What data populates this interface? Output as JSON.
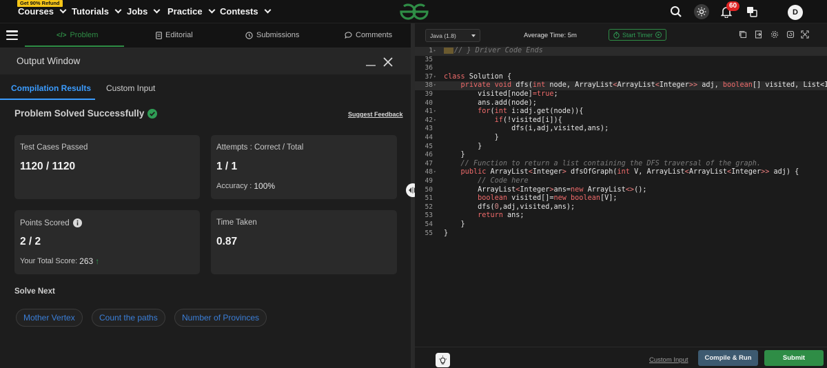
{
  "nav": {
    "refund_badge": "Get 90% Refund",
    "items": [
      {
        "label": "Courses"
      },
      {
        "label": "Tutorials"
      },
      {
        "label": "Jobs"
      },
      {
        "label": "Practice"
      },
      {
        "label": "Contests"
      }
    ],
    "notification_count": "60",
    "avatar_initial": "D",
    "icons": [
      "search-icon",
      "theme-toggle-icon",
      "bell-icon",
      "translate-icon"
    ]
  },
  "problem_tabs": [
    {
      "label": "Problem",
      "icon": "code-icon",
      "active": true
    },
    {
      "label": "Editorial",
      "icon": "document-icon",
      "active": false
    },
    {
      "label": "Submissions",
      "icon": "clock-icon",
      "active": false
    },
    {
      "label": "Comments",
      "icon": "comment-icon",
      "active": false
    }
  ],
  "output_window": {
    "title": "Output Window",
    "tabs": [
      {
        "label": "Compilation Results",
        "active": true
      },
      {
        "label": "Custom Input",
        "active": false
      }
    ],
    "status": "Problem Solved Successfully",
    "feedback_link": "Suggest Feedback",
    "cards": {
      "test_cases": {
        "label": "Test Cases Passed",
        "value": "1120 / 1120"
      },
      "attempts": {
        "label": "Attempts : Correct / Total",
        "value": "1 / 1",
        "sub_label": "Accuracy :",
        "sub_value": "100%"
      },
      "points": {
        "label": "Points Scored",
        "value": "2 / 2",
        "sub_label": "Your Total Score:",
        "sub_value": "263"
      },
      "time": {
        "label": "Time Taken",
        "value": "0.87"
      }
    },
    "solve_next": {
      "heading": "Solve Next",
      "items": [
        "Mother Vertex",
        "Count the paths",
        "Number of Provinces"
      ]
    }
  },
  "editor": {
    "language": "Java (1.8)",
    "average_time": "Average Time: 5m",
    "start_timer": "Start Timer",
    "lines": [
      {
        "n": "1",
        "fold": "▸",
        "html": "<span class=\"fold-mark\"></span><span class=\"cm\">// } Driver Code Ends</span>",
        "hl": true
      },
      {
        "n": "35",
        "fold": "",
        "html": ""
      },
      {
        "n": "36",
        "fold": "",
        "html": ""
      },
      {
        "n": "37",
        "fold": "▾",
        "html": "<span class=\"kw\">class</span> Solution {"
      },
      {
        "n": "38",
        "fold": "▾",
        "html": "    <span class=\"kw\">private</span> <span class=\"kw\">void</span> dfs(<span class=\"kw\">int</span> node, ArrayList<span class=\"gen\">&lt;</span>ArrayList<span class=\"gen\">&lt;</span>Integer<span class=\"gen\">&gt;&gt;</span> adj, <span class=\"kw\">boolean</span>[] visited, List&lt;Int",
        "hl": true
      },
      {
        "n": "39",
        "fold": "",
        "html": "        visited[node]<span class=\"kw\">=true</span>;"
      },
      {
        "n": "40",
        "fold": "",
        "html": "        ans.add(node);"
      },
      {
        "n": "41",
        "fold": "▾",
        "html": "        <span class=\"kw\">for</span>(<span class=\"kw\">int</span> i:adj.get(node)){"
      },
      {
        "n": "42",
        "fold": "▾",
        "html": "            <span class=\"kw\">if</span>(!visited[i]){"
      },
      {
        "n": "43",
        "fold": "",
        "html": "                dfs(i,adj,visited,ans);"
      },
      {
        "n": "44",
        "fold": "",
        "html": "            }"
      },
      {
        "n": "45",
        "fold": "",
        "html": "        }"
      },
      {
        "n": "46",
        "fold": "",
        "html": "    }"
      },
      {
        "n": "47",
        "fold": "",
        "html": "    <span class=\"cm\">// Function to return a list containing the DFS traversal of the graph.</span>"
      },
      {
        "n": "48",
        "fold": "▾",
        "html": "    <span class=\"kw\">public</span> ArrayList<span class=\"gen\">&lt;</span>Integer<span class=\"gen\">&gt;</span> dfsOfGraph(<span class=\"kw\">int</span> V, ArrayList<span class=\"gen\">&lt;</span>ArrayList<span class=\"gen\">&lt;</span>Integer<span class=\"gen\">&gt;&gt;</span> adj) {"
      },
      {
        "n": "49",
        "fold": "",
        "html": "        <span class=\"cm\">// Code here</span>"
      },
      {
        "n": "50",
        "fold": "",
        "html": "        ArrayList<span class=\"gen\">&lt;</span>Integer<span class=\"gen\">&gt;</span>ans=<span class=\"kw\">new</span> ArrayList<span class=\"gen\">&lt;&gt;</span>();"
      },
      {
        "n": "51",
        "fold": "",
        "html": "        <span class=\"kw\">boolean</span> visited[]=<span class=\"kw\">new</span> <span class=\"kw\">boolean</span>[V];"
      },
      {
        "n": "52",
        "fold": "",
        "html": "        dfs(<span class=\"nm\">0</span>,adj,visited,ans);"
      },
      {
        "n": "53",
        "fold": "",
        "html": "        <span class=\"kw\">return</span> ans;"
      },
      {
        "n": "54",
        "fold": "",
        "html": "    }"
      },
      {
        "n": "55",
        "fold": "",
        "html": "}"
      }
    ],
    "custom_input": "Custom Input",
    "compile_run": "Compile & Run",
    "submit": "Submit"
  },
  "colors": {
    "accent_green": "#2f8d46",
    "accent_blue": "#3b9cff",
    "notif_red": "#e02424",
    "background": "#131313"
  }
}
